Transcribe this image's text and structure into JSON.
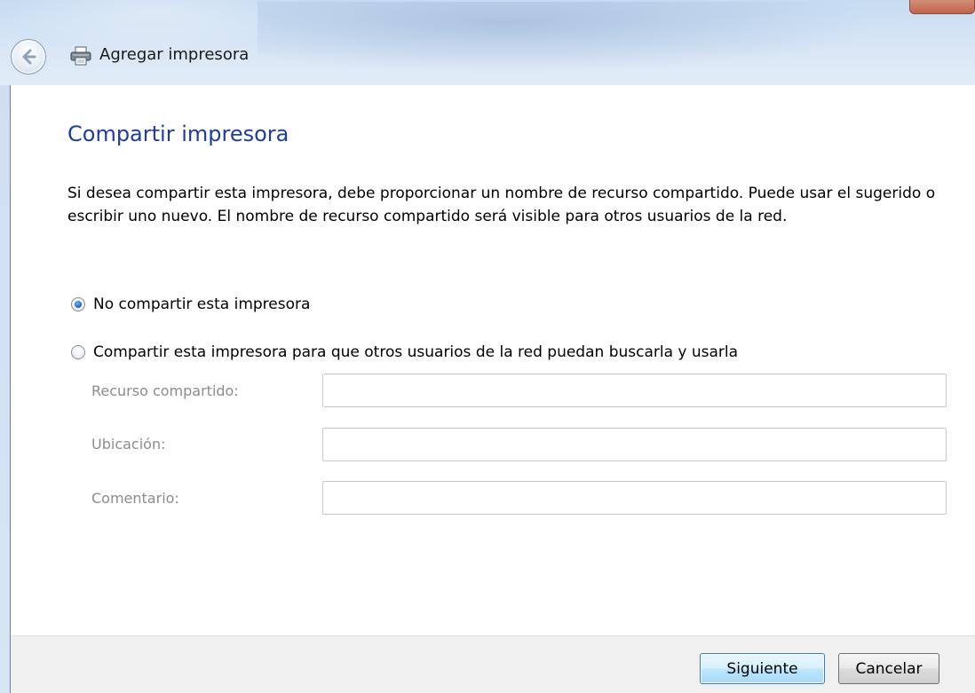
{
  "window": {
    "title": "Agregar impresora",
    "back_icon": "back-arrow-icon",
    "printer_icon": "printer-icon"
  },
  "page": {
    "heading": "Compartir impresora",
    "description": "Si desea compartir esta impresora, debe proporcionar un nombre de recurso compartido. Puede usar el sugerido o escribir uno nuevo. El nombre de recurso compartido será visible para otros usuarios de la red."
  },
  "options": {
    "no_share": {
      "label": "No compartir esta impresora",
      "selected": true
    },
    "share": {
      "label": "Compartir esta impresora para que otros usuarios de la red puedan buscarla y usarla",
      "selected": false
    }
  },
  "fields": {
    "share_name": {
      "label": "Recurso compartido:",
      "value": ""
    },
    "location": {
      "label": "Ubicación:",
      "value": ""
    },
    "comment": {
      "label": "Comentario:",
      "value": ""
    }
  },
  "buttons": {
    "next": "Siguiente",
    "cancel": "Cancelar"
  },
  "colors": {
    "heading": "#1e3d9c",
    "disabled_label": "#8c8c8c",
    "footer_bg": "#f0f0f0"
  }
}
